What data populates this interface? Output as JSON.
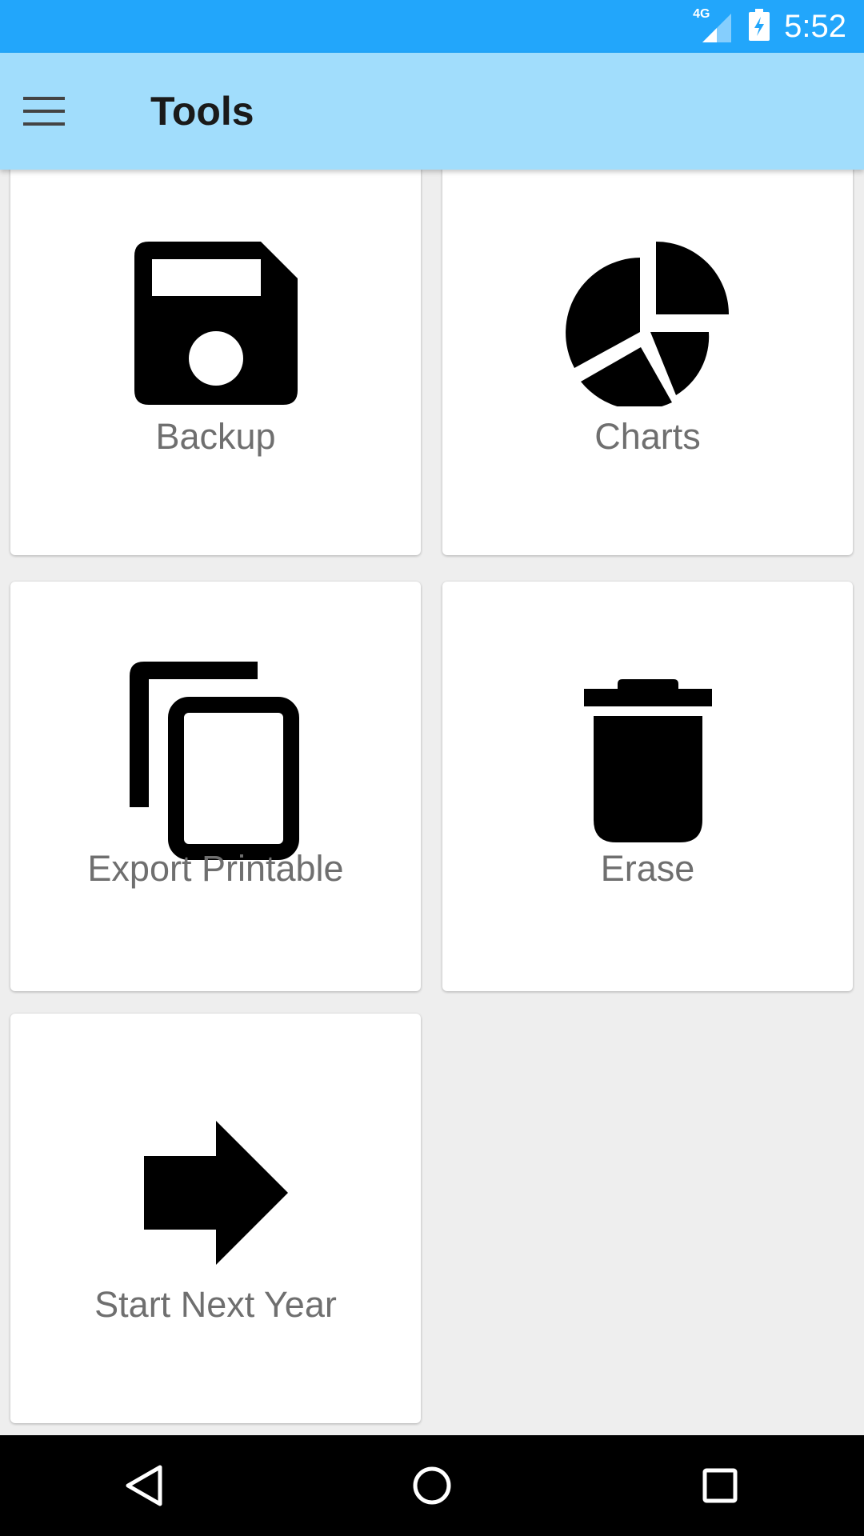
{
  "status_bar": {
    "network": "4G",
    "time": "5:52"
  },
  "app_bar": {
    "title": "Tools",
    "menu_icon": "hamburger-menu-icon"
  },
  "tools": [
    {
      "label": "Backup",
      "icon": "floppy-disk-icon"
    },
    {
      "label": "Charts",
      "icon": "pie-chart-icon"
    },
    {
      "label": "Export Printable",
      "icon": "copy-icon"
    },
    {
      "label": "Erase",
      "icon": "trash-icon"
    },
    {
      "label": "Start Next Year",
      "icon": "arrow-right-icon"
    }
  ],
  "nav_bar": {
    "back_icon": "back-icon",
    "home_icon": "home-icon",
    "recents_icon": "recents-icon"
  },
  "colors": {
    "status_bar": "#22a6fb",
    "app_bar": "#a1ddfc",
    "background": "#eeeeee",
    "card": "#ffffff",
    "label_text": "#6f6f6f"
  }
}
